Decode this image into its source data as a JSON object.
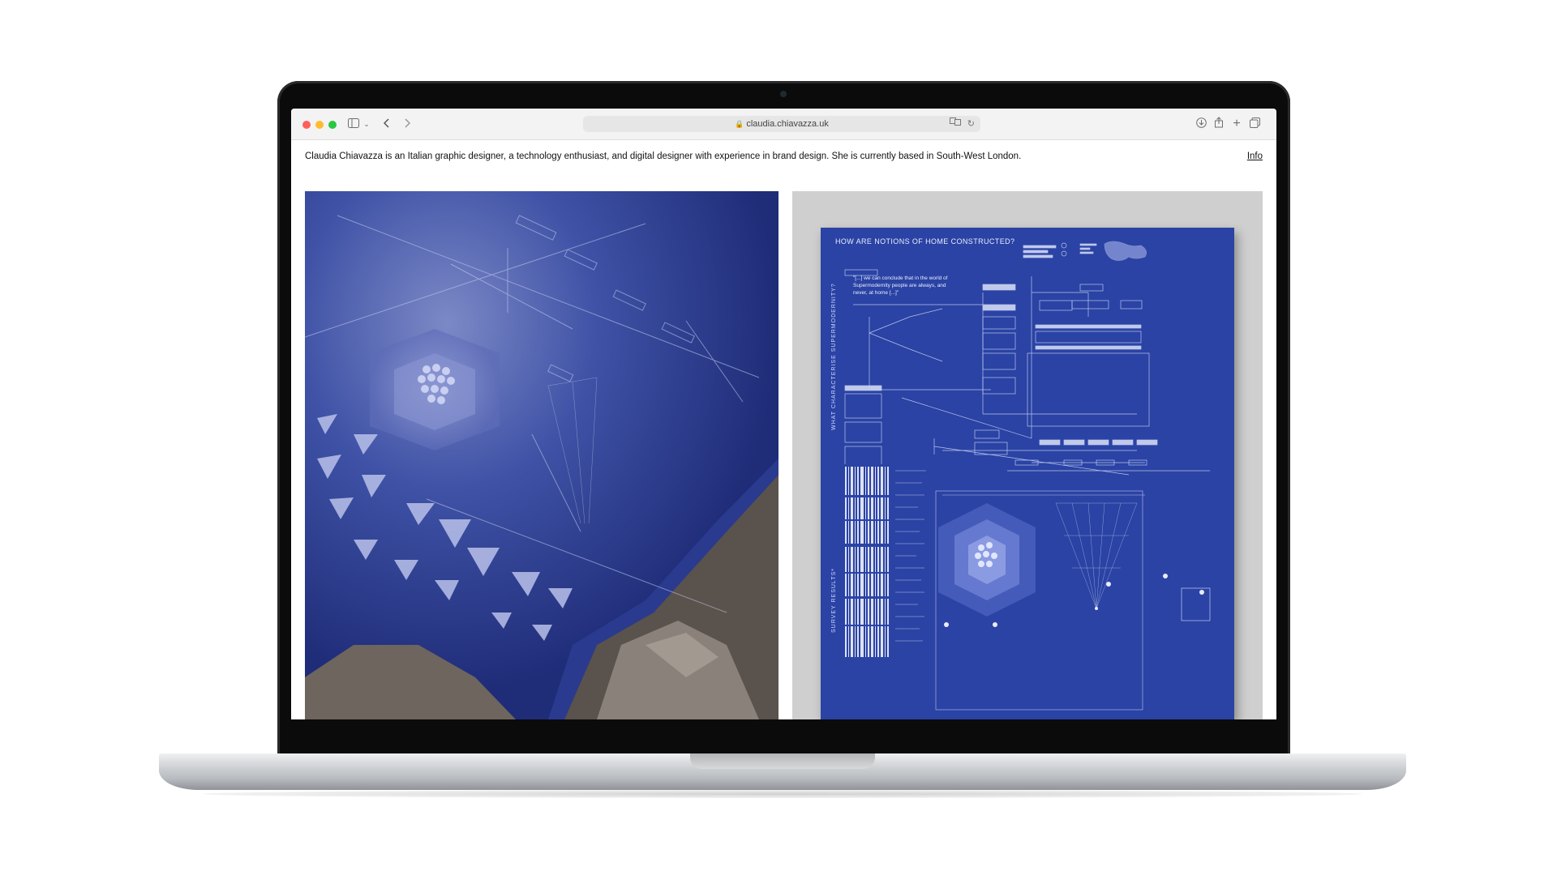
{
  "browser": {
    "url": "claudia.chiavazza.uk",
    "icons": {
      "sidebar": "sidebar-icon",
      "back": "chevron-left-icon",
      "forward": "chevron-right-icon",
      "download": "download-icon",
      "share": "share-icon",
      "new_tab": "plus-icon",
      "tabs": "tab-overview-icon"
    }
  },
  "page": {
    "intro": "Claudia Chiavazza is an Italian graphic designer, a technology enthusiast, and digital designer with experience in brand design. She is currently based in South-West London.",
    "info_link": "Info"
  },
  "poster": {
    "title": "HOW ARE NOTIONS OF HOME CONSTRUCTED?",
    "side_label_1": "WHAT CHARACTERISE SUPERMODERNITY?",
    "side_label_2": "SURVEY RESULTS*",
    "quote": "\"[...] we can conclude that in the world of Supermodernity people are always, and never, at home [...]\""
  },
  "colors": {
    "poster_blue": "#2a43a4",
    "photo_blue": "#2c3f94",
    "right_panel_bg": "#cfcfcf"
  }
}
